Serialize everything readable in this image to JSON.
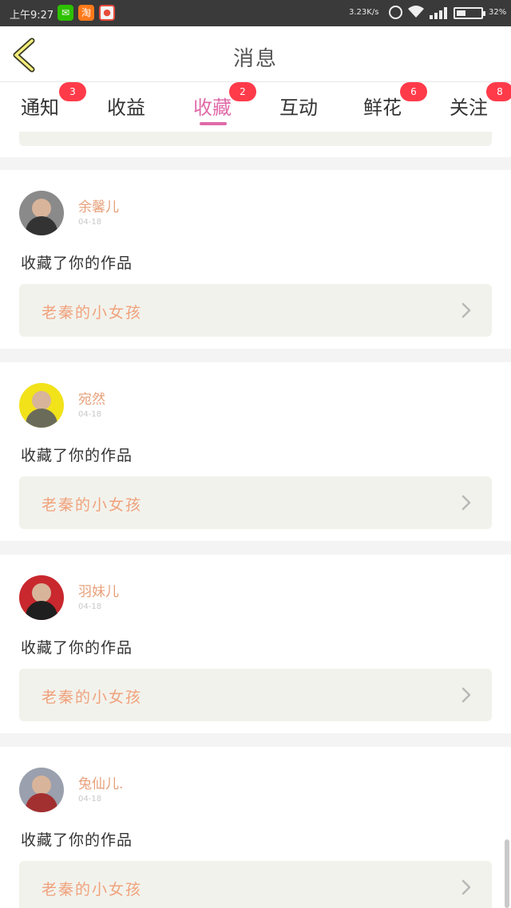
{
  "status_bar": {
    "time": "上午9:27",
    "net_speed": "3.23K/s",
    "battery_pct": "32%",
    "battery_level": 0.32,
    "apps": [
      "wechat-icon",
      "taobao-icon",
      "app-icon"
    ]
  },
  "header": {
    "title": "消息",
    "back_icon": "chevron-left-icon"
  },
  "tabs": [
    {
      "label": "通知",
      "badge": "3"
    },
    {
      "label": "收益",
      "badge": ""
    },
    {
      "label": "收藏",
      "badge": "2",
      "active": true
    },
    {
      "label": "互动",
      "badge": ""
    },
    {
      "label": "鲜花",
      "badge": "6"
    },
    {
      "label": "关注",
      "badge": "8"
    }
  ],
  "colors": {
    "accent": "#e06aa8",
    "badge": "#ff3b4a",
    "username": "#e7a07a",
    "work_title": "#f0a27c",
    "work_bg": "#f2f2ec"
  },
  "messages": [
    {
      "user": "余馨儿",
      "date": "04-18",
      "action": "收藏了你的作品",
      "work": "老秦的小女孩"
    },
    {
      "user": "宛然",
      "date": "04-18",
      "action": "收藏了你的作品",
      "work": "老秦的小女孩"
    },
    {
      "user": "羽妹儿",
      "date": "04-18",
      "action": "收藏了你的作品",
      "work": "老秦的小女孩"
    },
    {
      "user": "兔仙儿.",
      "date": "04-18",
      "action": "收藏了你的作品",
      "work": "老秦的小女孩"
    }
  ]
}
